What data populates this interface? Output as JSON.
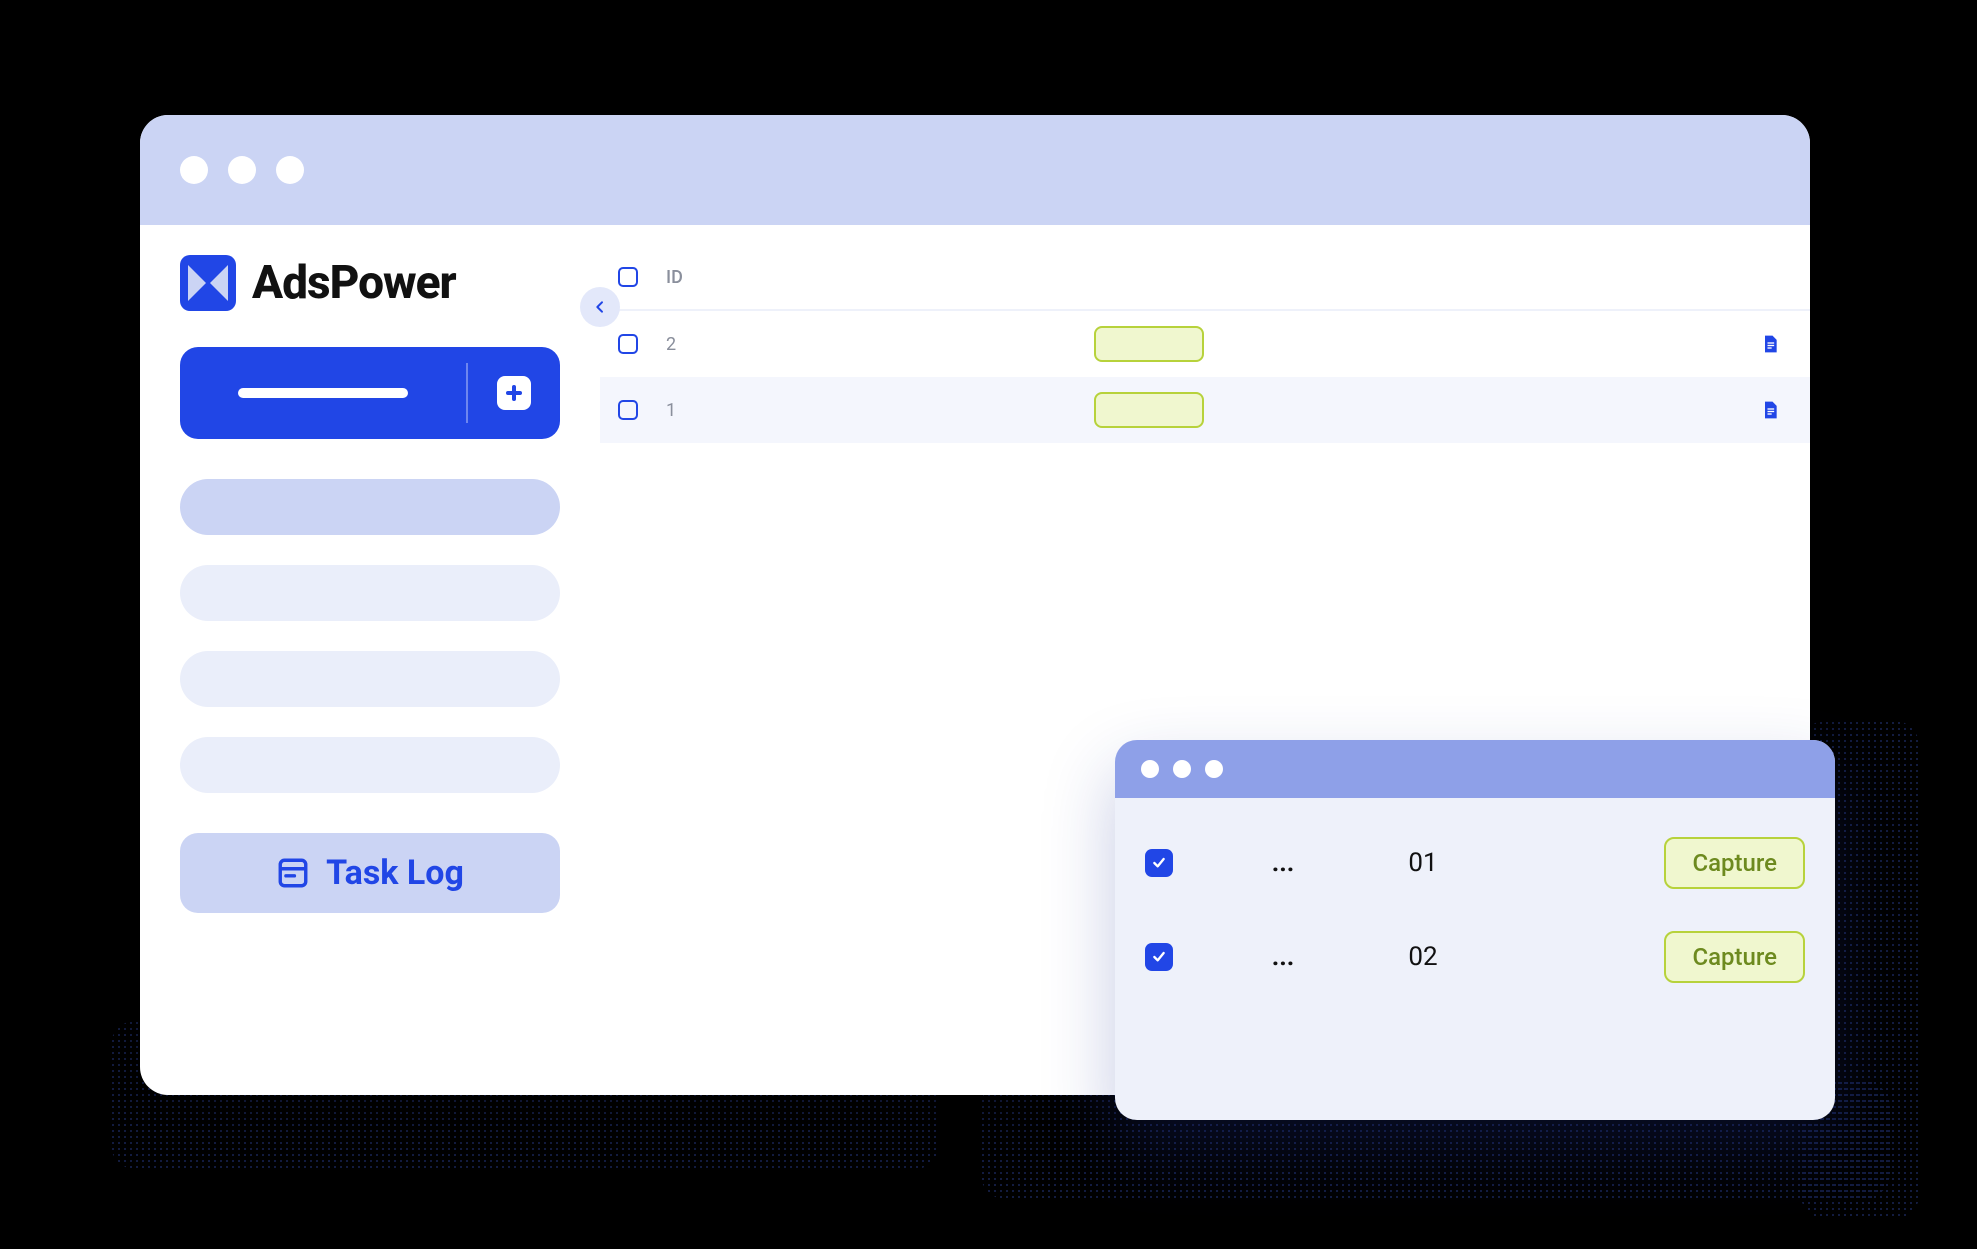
{
  "app": {
    "name": "AdsPower"
  },
  "sidebar": {
    "tasklog_label": "Task Log"
  },
  "table": {
    "header": {
      "id_label": "ID"
    },
    "rows": [
      {
        "id": "2"
      },
      {
        "id": "1"
      }
    ]
  },
  "popup": {
    "rows": [
      {
        "dots": "...",
        "num": "01",
        "action": "Capture"
      },
      {
        "dots": "...",
        "num": "02",
        "action": "Capture"
      }
    ]
  }
}
